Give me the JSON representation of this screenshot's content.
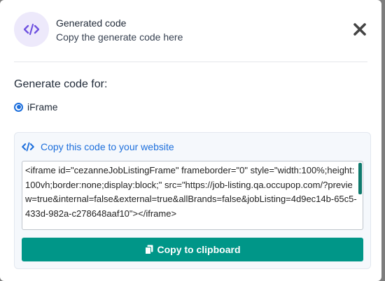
{
  "header": {
    "title": "Generated code",
    "subtitle": "Copy the generate code here",
    "icon": "code-icon"
  },
  "generate": {
    "label": "Generate code for:",
    "option": "iFrame",
    "selected": true
  },
  "panel": {
    "title": "Copy this code to your website",
    "code": "<iframe id=\"cezanneJobListingFrame\" frameborder=\"0\" style=\"width:100%;height:100vh;border:none;display:block;\" src=\"https://job-listing.qa.occupop.com/?preview=true&internal=false&external=true&allBrands=false&jobListing=4d9ec14b-65c5-433d-982a-c278648aaf10\"></iframe>",
    "copy_label": "Copy to clipboard"
  },
  "colors": {
    "accent_blue": "#1d6fdc",
    "button_teal": "#009688",
    "icon_bg": "#ede9fb",
    "icon_purple": "#6f52e0"
  }
}
